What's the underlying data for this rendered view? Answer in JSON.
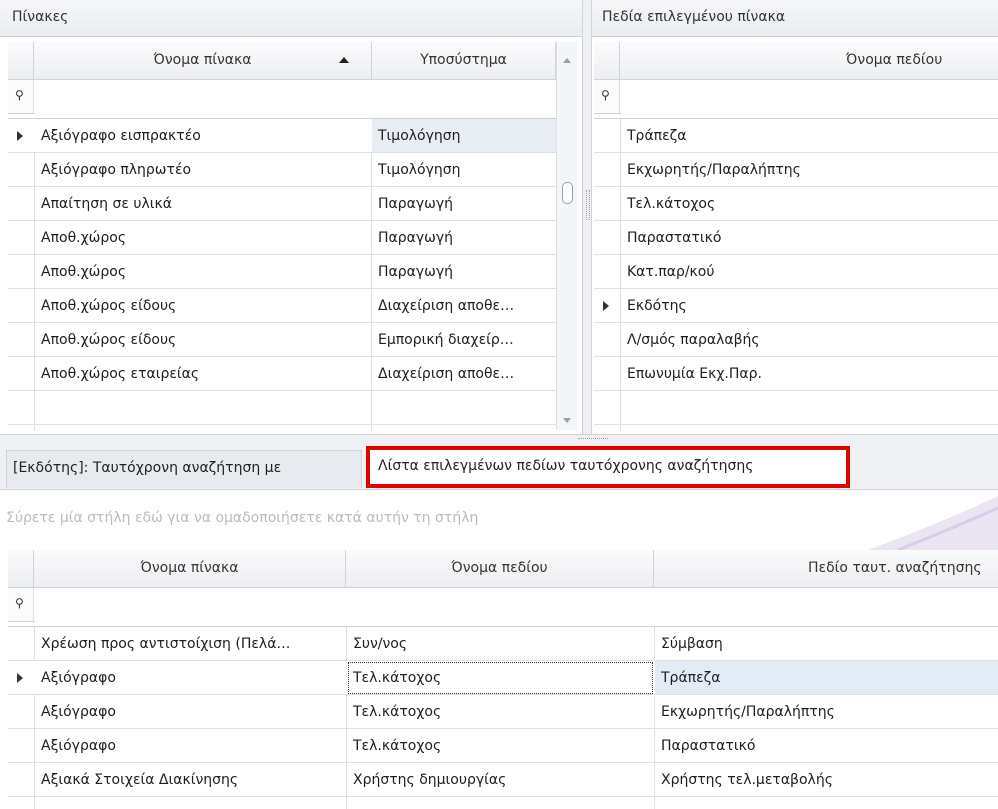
{
  "tables_panel": {
    "title": "Πίνακες",
    "col_table_name": "Όνομα πίνακα",
    "col_subsystem": "Υποσύστημα",
    "rows": [
      {
        "name": "Αξιόγραφο εισπρακτέο",
        "subsystem": "Τιμολόγηση"
      },
      {
        "name": "Αξιόγραφο πληρωτέο",
        "subsystem": "Τιμολόγηση"
      },
      {
        "name": "Απαίτηση σε υλικά",
        "subsystem": "Παραγωγή"
      },
      {
        "name": "Αποθ.χώρος",
        "subsystem": "Παραγωγή"
      },
      {
        "name": "Αποθ.χώρος",
        "subsystem": "Παραγωγή"
      },
      {
        "name": "Αποθ.χώρος είδους",
        "subsystem": "Διαχείριση αποθε…"
      },
      {
        "name": "Αποθ.χώρος είδους",
        "subsystem": "Εμπορική διαχείρ…"
      },
      {
        "name": "Αποθ.χώρος εταιρείας",
        "subsystem": "Διαχείριση αποθε…"
      }
    ]
  },
  "fields_panel": {
    "title": "Πεδία επιλεγμένου πίνακα",
    "col_field_name": "Όνομα πεδίου",
    "rows": [
      "Τράπεζα",
      "Εκχωρητής/Παραλήπτης",
      "Τελ.κάτοχος",
      "Παραστατικό",
      "Κατ.παρ/κού",
      "Εκδότης",
      "Λ/σμός παραλαβής",
      "Επωνυμία Εκχ.Παρ."
    ]
  },
  "tabs": {
    "tab1": "[Εκδότης]: Ταυτόχρονη αναζήτηση με",
    "tab2": "Λίστα επιλεγμένων πεδίων ταυτόχρονης αναζήτησης"
  },
  "group_panel_hint": "Σύρετε μία στήλη εδώ για να ομαδοποιήσετε κατά αυτήν τη στήλη",
  "selected_grid": {
    "col_table_name": "Όνομα πίνακα",
    "col_field_name": "Όνομα πεδίου",
    "col_search_field": "Πεδίο ταυτ. αναζήτησης",
    "rows": [
      {
        "table": "Χρέωση προς αντιστοίχιση (Πελά…",
        "field": "Συν/νος",
        "search": "Σύμβαση"
      },
      {
        "table": "Αξιόγραφο",
        "field": "Τελ.κάτοχος",
        "search": "Τράπεζα"
      },
      {
        "table": "Αξιόγραφο",
        "field": "Τελ.κάτοχος",
        "search": "Εκχωρητής/Παραλήπτης"
      },
      {
        "table": "Αξιόγραφο",
        "field": "Τελ.κάτοχος",
        "search": "Παραστατικό"
      },
      {
        "table": "Αξιακά Στοιχεία Διακίνησης",
        "field": "Χρήστης δημιουργίας",
        "search": "Χρήστης τελ.μεταβολής"
      }
    ]
  },
  "colors": {
    "accent_red": "#e60000",
    "selected_row": "#e3ebf6"
  },
  "icons": {
    "filter": "filter-icon",
    "row_indicator": "row-indicator-icon"
  }
}
